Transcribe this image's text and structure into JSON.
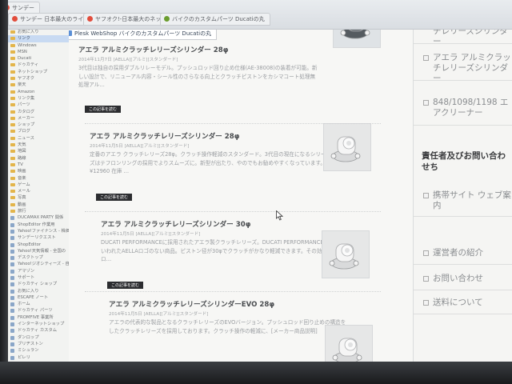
{
  "tabs": [
    {
      "label": "サンデー",
      "color": "#e24d3c"
    },
    {
      "label": "サンデー 日本最大のライ",
      "color": "#e24d3c"
    },
    {
      "label": "ヤフオク!-日本最大のネット",
      "color": "#e24d3c"
    },
    {
      "label": "バイクのカスタムパーツ Ducatiの丸",
      "color": "#6b9d2e"
    }
  ],
  "active_tab": "Plesk WebShop バイクのカスタムパーツ Ducatiの丸",
  "sidebar": {
    "items": [
      "お気に入り",
      "リンク",
      "Windows",
      "MSN",
      "Ducati",
      "ドゥカティ",
      "ネットショップ",
      "ヤフオク",
      "楽天",
      "Amazon",
      "リンク集",
      "パーツ",
      "カタログ",
      "メーカー",
      "ショップ",
      "ブログ",
      "ニュース",
      "天気",
      "地図",
      "路線",
      "TV",
      "映画",
      "音楽",
      "ゲーム",
      "メール",
      "写真",
      "動画",
      "旅行",
      "DUCAMAX PARTY 関係",
      "ShopEditor 作業用",
      "Yahoo!ファイナンス - 株価・",
      "サンデーリクエスト",
      "ShopEditor",
      "Yahoo!天気情報 - 全国の",
      "デスクトップ",
      "Yahoo!ジオシティーズ - 自",
      "アマゾン",
      "サポート",
      "ドゥカティ ショップ",
      "お気に入り",
      "ESCAPE ノート",
      "ホーム",
      "ドゥカティ パーツ",
      "FROMFIVE 事業所",
      "インターネットショップ",
      "ドゥカティ カスタム",
      "ダンロップ",
      "ブリヂストン",
      "ミシュラン",
      "ピレリ"
    ]
  },
  "articles": [
    {
      "title": "アエラ アルミクラッチレリーズシリンダー 28φ",
      "date": "2014年11月7日",
      "category": "[AELLA][アルミ][スタンダード]",
      "excerpt": "3代目は独自の採用ダブルリレーモデル。プッシュロッド回り止め仕様(AE-38008)の装着が可能。新しい設計で、リニューアル内容・シール性のさらなる向上とクラッチピストンをカシマコート処理無処理アル…",
      "read_more": "この記事を読む"
    },
    {
      "title": "アエラ アルミクラッチレリーズシリンダー 28φ",
      "date": "2014年11月5日",
      "category": "[AELLA][アルミ][スタンダード]",
      "excerpt": "定番のアエラ クラッチレリーズ28φ。クラッチ操作軽減のスタンダード。3代目の現在になるシリーズはテフロンリングの採用でよりスムーズに。新型が出たり、やのでもお勧めやすくなっています。¥12960 在庫 …",
      "read_more": "この記事を読む"
    },
    {
      "title": "アエラ アルミクラッチレリーズシリンダー 30φ",
      "date": "2014年11月5日",
      "category": "[AELLA][アルミ][スタンダード]",
      "excerpt": "DUCATI PERFORMANCEに採用されたアエラ製クラッチレリーズ。DUCATI PERFORMANCEでは、いわれたAELLAロゴのない商品。ピストン径が30φでクラッチがかなり軽減できます。その効果でロ…",
      "read_more": "この記事を読む"
    },
    {
      "title": "アエラ アルミクラッチレリーズシリンダーEVO 28φ",
      "date": "2014年11月5日",
      "category": "[AELLA][アルミ][スタンダード]",
      "excerpt": "アエラの代表的な製品となるクラッチレリーズのEVOバージョン。プッシュロッド回り止めの構造をしたクラッチレリーズを採用しております。クラッチ操作の軽減に、[メーカー商品説明]",
      "read_more": "この記事を読む"
    }
  ],
  "rightcol": {
    "top_links": [
      "アエラ アルミクラッチレリーズシリンダー",
      "アエラ アルミクラッチレリーズシリンダー",
      "848/1098/1198 エアクリーナー"
    ],
    "heading": "責任者及びお問い合わせち",
    "links": [
      "携帯サイト ウェブ案内",
      "運営者の紹介",
      "お問い合わせ",
      "送料について"
    ]
  },
  "colors": {
    "text_primary": "#4a4d50",
    "read_more_bg": "#2c2d30",
    "folder": "#e3b54b",
    "active_bookmark": "#c8daf2"
  }
}
